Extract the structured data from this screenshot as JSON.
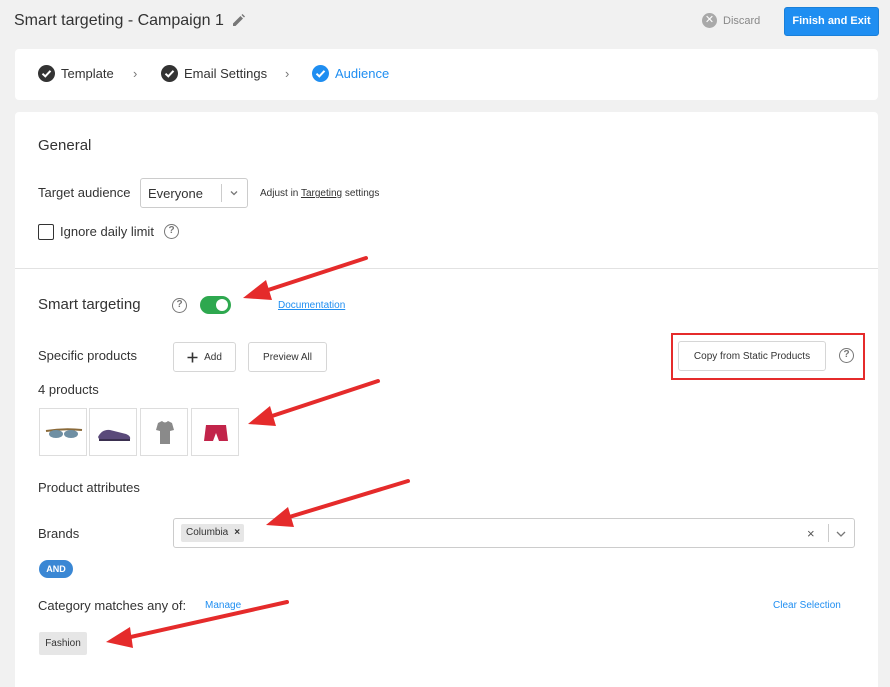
{
  "header": {
    "title": "Smart targeting - Campaign 1",
    "discard_label": "Discard",
    "finish_label": "Finish and Exit"
  },
  "steps": [
    {
      "label": "Template",
      "state": "done"
    },
    {
      "label": "Email Settings",
      "state": "done"
    },
    {
      "label": "Audience",
      "state": "active"
    }
  ],
  "general": {
    "title": "General",
    "target_audience_label": "Target audience",
    "target_audience_value": "Everyone",
    "hint_prefix": "Adjust in",
    "hint_link": "Targeting",
    "hint_suffix": "settings",
    "ignore_daily_limit_label": "Ignore daily limit",
    "ignore_daily_limit_checked": false
  },
  "smart_targeting": {
    "title": "Smart targeting",
    "enabled": true,
    "documentation_link": "Documentation",
    "specific_products_label": "Specific products",
    "add_label": "Add",
    "preview_all_label": "Preview All",
    "copy_label": "Copy from Static Products",
    "products_count": "4 products",
    "products": [
      {
        "icon": "sunglasses-icon"
      },
      {
        "icon": "shoe-icon"
      },
      {
        "icon": "tshirt-icon"
      },
      {
        "icon": "shorts-icon"
      }
    ],
    "product_attributes_title": "Product attributes",
    "brands_label": "Brands",
    "brands_selected": [
      "Columbia"
    ],
    "and_badge": "AND",
    "category_label": "Category matches any of:",
    "manage_link": "Manage",
    "clear_selection_link": "Clear Selection",
    "categories_selected": [
      "Fashion"
    ]
  },
  "colors": {
    "primary": "#1f8ef1",
    "toggle_on": "#2ea84f",
    "annotation_red": "#e52b2b",
    "and_badge": "#3a87d4"
  }
}
